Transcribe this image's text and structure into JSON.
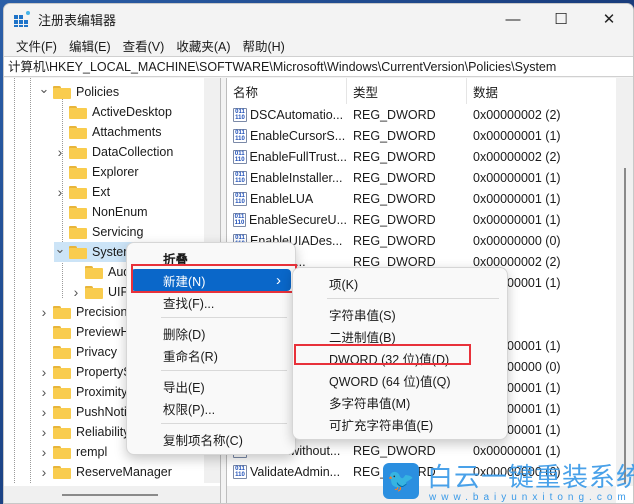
{
  "window": {
    "title": "注册表编辑器",
    "controls": {
      "minimize": "—",
      "maximize": "☐",
      "close": "✕"
    }
  },
  "menubar": [
    "文件(F)",
    "编辑(E)",
    "查看(V)",
    "收藏夹(A)",
    "帮助(H)"
  ],
  "address": "计算机\\HKEY_LOCAL_MACHINE\\SOFTWARE\\Microsoft\\Windows\\CurrentVersion\\Policies\\System",
  "tree": [
    {
      "label": "Policies",
      "expander": "expanded",
      "level": 0
    },
    {
      "label": "ActiveDesktop",
      "expander": "none",
      "level": 1
    },
    {
      "label": "Attachments",
      "expander": "none",
      "level": 1
    },
    {
      "label": "DataCollection",
      "expander": "collapsed",
      "level": 1
    },
    {
      "label": "Explorer",
      "expander": "none",
      "level": 1
    },
    {
      "label": "Ext",
      "expander": "collapsed",
      "level": 1
    },
    {
      "label": "NonEnum",
      "expander": "none",
      "level": 1
    },
    {
      "label": "Servicing",
      "expander": "none",
      "level": 1
    },
    {
      "label": "System",
      "expander": "expanded",
      "level": 1,
      "selected": true
    },
    {
      "label": "Aud",
      "expander": "none",
      "level": 2
    },
    {
      "label": "UIPI",
      "expander": "collapsed",
      "level": 2
    },
    {
      "label": "PrecisionT",
      "expander": "collapsed",
      "level": 0
    },
    {
      "label": "PreviewH",
      "expander": "none",
      "level": 0
    },
    {
      "label": "Privacy",
      "expander": "none",
      "level": 0
    },
    {
      "label": "PropertyS",
      "expander": "collapsed",
      "level": 0
    },
    {
      "label": "Proximity",
      "expander": "collapsed",
      "level": 0
    },
    {
      "label": "PushNotif",
      "expander": "collapsed",
      "level": 0
    },
    {
      "label": "Reliability",
      "expander": "collapsed",
      "level": 0
    },
    {
      "label": "rempl",
      "expander": "collapsed",
      "level": 0
    },
    {
      "label": "ReserveManager",
      "expander": "collapsed",
      "level": 0
    }
  ],
  "list": {
    "headers": {
      "name": "名称",
      "type": "类型",
      "data": "数据"
    },
    "rows": [
      {
        "name": "DSCAutomatio...",
        "type": "REG_DWORD",
        "data": "0x00000002 (2)"
      },
      {
        "name": "EnableCursorS...",
        "type": "REG_DWORD",
        "data": "0x00000001 (1)"
      },
      {
        "name": "EnableFullTrust...",
        "type": "REG_DWORD",
        "data": "0x00000002 (2)"
      },
      {
        "name": "EnableInstaller...",
        "type": "REG_DWORD",
        "data": "0x00000001 (1)"
      },
      {
        "name": "EnableLUA",
        "type": "REG_DWORD",
        "data": "0x00000001 (1)"
      },
      {
        "name": "EnableSecureU...",
        "type": "REG_DWORD",
        "data": "0x00000001 (1)"
      },
      {
        "name": "EnableUIADes...",
        "type": "REG_DWORD",
        "data": "0x00000000 (0)"
      },
      {
        "name": "...wpSta...",
        "type": "REG_DWORD",
        "data": "0x00000002 (2)"
      },
      {
        "name": "",
        "type": "",
        "data": "0x00000001 (1)"
      },
      {
        "name": "",
        "type": "",
        "data": ""
      },
      {
        "name": "",
        "type": "",
        "data": ""
      },
      {
        "name": "",
        "type": "",
        "data": "0x00000001 (1)"
      },
      {
        "name": "",
        "type": "",
        "data": "0x00000000 (0)"
      },
      {
        "name": "",
        "type": "",
        "data": "0x00000001 (1)"
      },
      {
        "name": "",
        "type": "",
        "data": "0x00000001 (1)"
      },
      {
        "name": "",
        "type": "",
        "data": "0x00000001 (1)"
      },
      {
        "name": "undockwithout...",
        "type": "REG_DWORD",
        "data": "0x00000001 (1)"
      },
      {
        "name": "ValidateAdmin...",
        "type": "REG_DWORD",
        "data": "0x00000000 (0)"
      }
    ]
  },
  "context_menu": {
    "items": [
      {
        "label": "折叠",
        "bold": true
      },
      {
        "label": "新建(N)",
        "highlighted": true,
        "submenu": true
      },
      {
        "label": "查找(F)..."
      },
      {
        "separator": true
      },
      {
        "label": "删除(D)"
      },
      {
        "label": "重命名(R)"
      },
      {
        "separator": true
      },
      {
        "label": "导出(E)"
      },
      {
        "label": "权限(P)..."
      },
      {
        "separator": true
      },
      {
        "label": "复制项名称(C)"
      }
    ]
  },
  "submenu": {
    "items": [
      {
        "label": "项(K)"
      },
      {
        "separator": true
      },
      {
        "label": "字符串值(S)"
      },
      {
        "label": "二进制值(B)"
      },
      {
        "label": "DWORD (32 位)值(D)",
        "annotated": true
      },
      {
        "label": "QWORD (64 位)值(Q)"
      },
      {
        "label": "多字符串值(M)"
      },
      {
        "label": "可扩充字符串值(E)"
      }
    ]
  },
  "watermark": {
    "brand": "白云一键重装系统",
    "url": "www.baiyunxitong.com"
  },
  "colors": {
    "highlight": "#0a67c9",
    "annotation": "#e8313a",
    "selection": "#cce4f7",
    "folder": "#f9cc4e"
  }
}
